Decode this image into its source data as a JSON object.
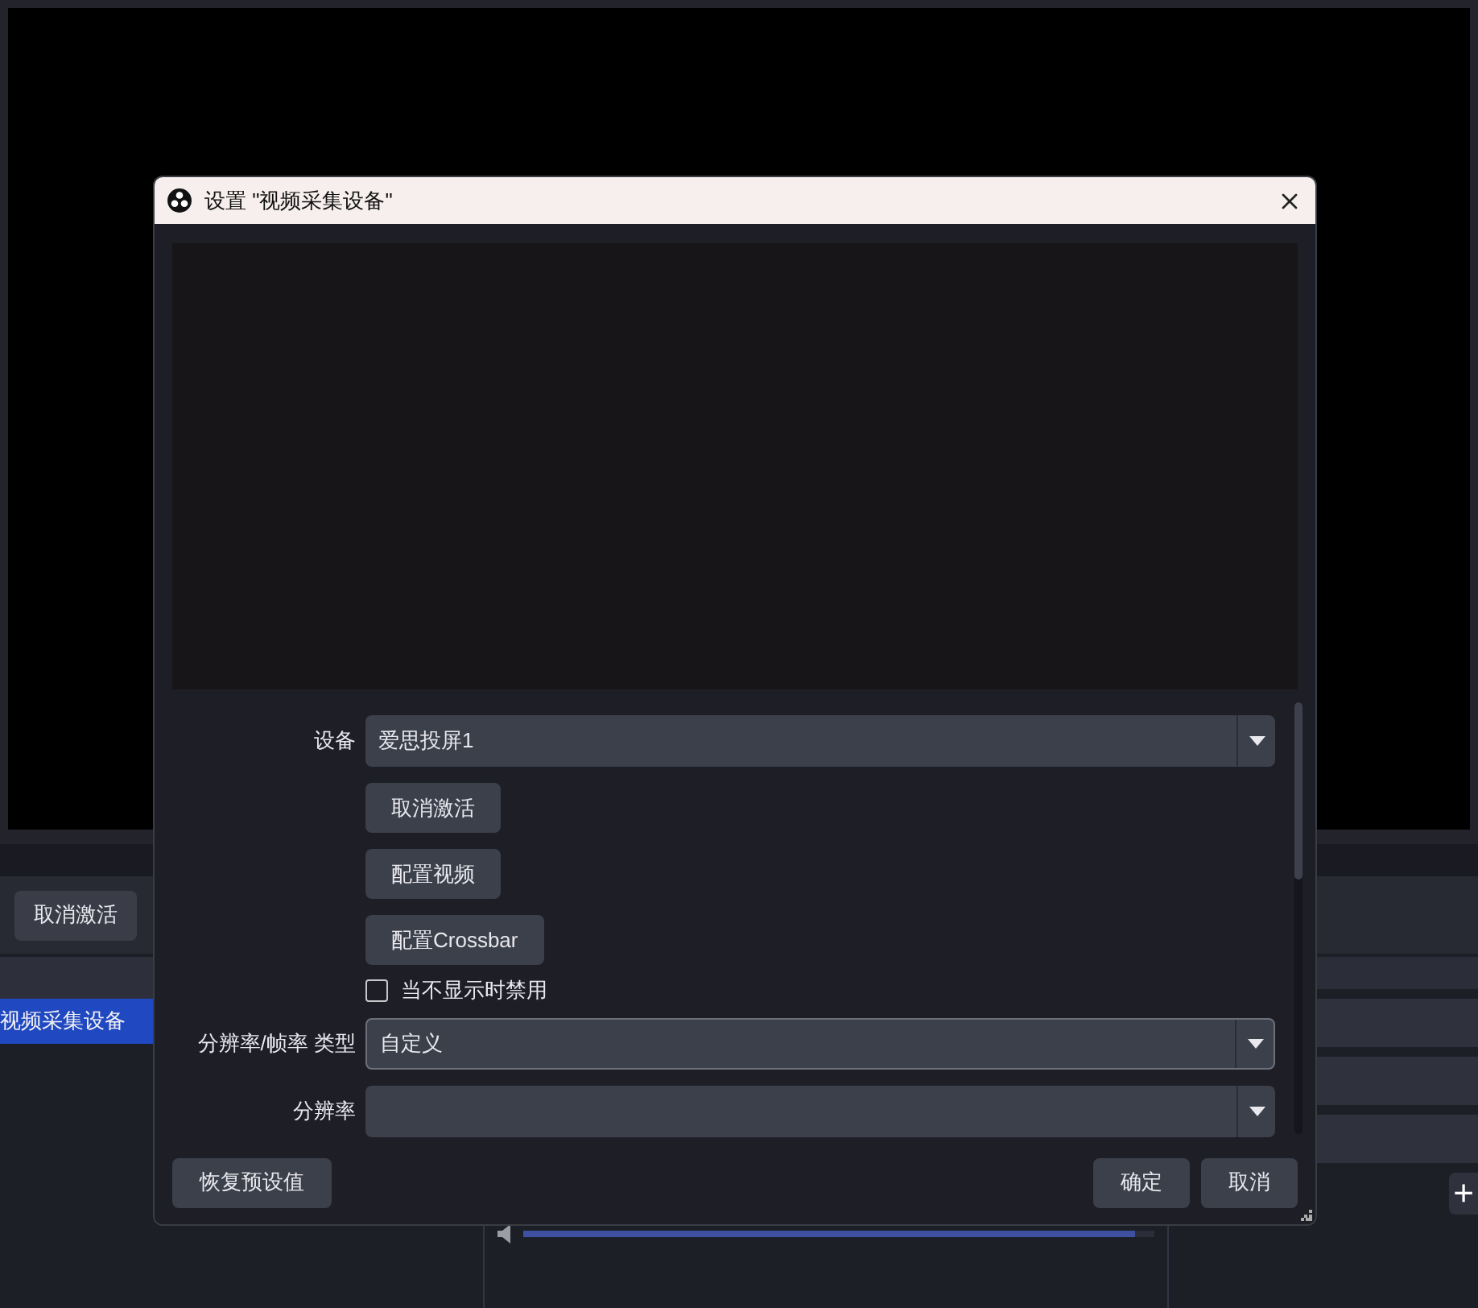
{
  "background": {
    "toolbar": {
      "buttons": [
        "取消激活"
      ]
    },
    "sources": [
      {
        "label": "视频采集设备",
        "selected": true
      }
    ],
    "mixer": {
      "level": 0.97
    },
    "add_button": "+"
  },
  "dialog": {
    "title": "设置 \"视频采集设备\"",
    "form": [
      {
        "kind": "select",
        "label": "设备",
        "value": "爱思投屏1"
      },
      {
        "kind": "button",
        "text": "取消激活"
      },
      {
        "kind": "button",
        "text": "配置视频"
      },
      {
        "kind": "button",
        "text": "配置Crossbar"
      },
      {
        "kind": "checkbox",
        "text": "当不显示时禁用",
        "checked": false
      },
      {
        "kind": "select",
        "label": "分辨率/帧率 类型",
        "value": "自定义"
      },
      {
        "kind": "select",
        "label": "分辨率"
      }
    ],
    "footer": {
      "left": [
        "恢复预设值"
      ],
      "right": [
        "确定",
        "取消"
      ]
    }
  }
}
